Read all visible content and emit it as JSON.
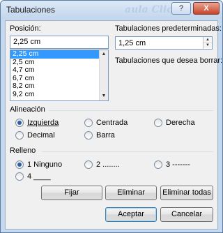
{
  "window": {
    "title": "Tabulaciones",
    "help_label": "?",
    "close_label": "X",
    "watermark": "aula Clic"
  },
  "position": {
    "label": "Posición:",
    "value": "2,25 cm",
    "items": [
      "2,25 cm",
      "2,5 cm",
      "4,7 cm",
      "6,7 cm",
      "8,2 cm",
      "9,2 cm"
    ],
    "selected_index": 0
  },
  "default_tabs": {
    "label": "Tabulaciones predeterminadas:",
    "value": "1,25 cm"
  },
  "to_clear": {
    "label": "Tabulaciones que desea borrar:"
  },
  "alignment": {
    "heading": "Alineación",
    "options": [
      {
        "label": "Izquierda",
        "selected": true
      },
      {
        "label": "Centrada",
        "selected": false
      },
      {
        "label": "Derecha",
        "selected": false
      },
      {
        "label": "Decimal",
        "selected": false
      },
      {
        "label": "Barra",
        "selected": false
      }
    ]
  },
  "leader": {
    "heading": "Relleno",
    "options": [
      {
        "label": "1 Ninguno",
        "selected": true
      },
      {
        "label": "2 ........",
        "selected": false
      },
      {
        "label": "3 -------",
        "selected": false
      },
      {
        "label": "4 ____",
        "selected": false
      }
    ]
  },
  "buttons": {
    "set": "Fijar",
    "clear": "Eliminar",
    "clear_all": "Eliminar todas",
    "ok": "Aceptar",
    "cancel": "Cancelar"
  }
}
